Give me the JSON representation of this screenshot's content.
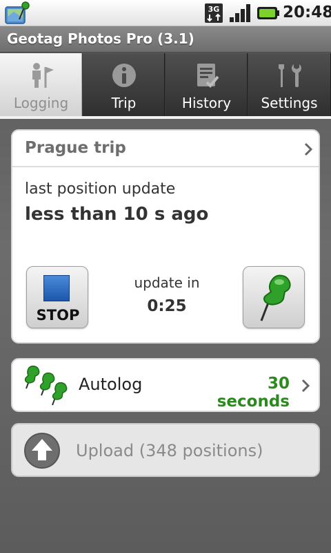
{
  "status_bar": {
    "network": "3G",
    "time": "20:48",
    "icons": [
      "app-map-icon",
      "3g-data-icon",
      "signal-strength-icon",
      "battery-icon"
    ]
  },
  "app": {
    "title": "Geotag Photos Pro (3.1)"
  },
  "tabs": [
    {
      "label": "Logging",
      "icon": "logging-person-flag-icon",
      "active": true
    },
    {
      "label": "Trip",
      "icon": "info-icon",
      "active": false
    },
    {
      "label": "History",
      "icon": "history-checklist-icon",
      "active": false
    },
    {
      "label": "Settings",
      "icon": "settings-tools-icon",
      "active": false
    }
  ],
  "trip": {
    "name": "Prague trip",
    "last_update_label": "last position update",
    "last_update_value": "less than 10 s ago",
    "stop_label": "STOP",
    "update_in_label": "update in",
    "update_in_value": "0:25"
  },
  "autolog": {
    "label": "Autolog",
    "value": "30 seconds"
  },
  "upload": {
    "label": "Upload (348 positions)"
  },
  "colors": {
    "accent_green": "#2a8a1c",
    "stop_blue": "#1c56ad",
    "background": "#606060"
  }
}
